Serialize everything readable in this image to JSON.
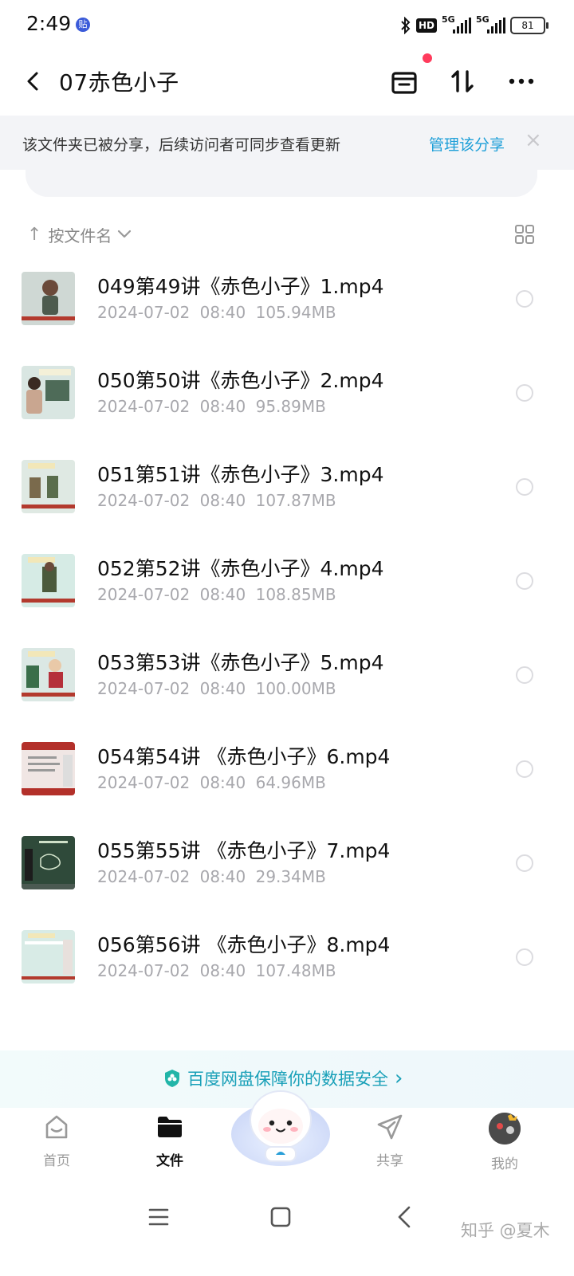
{
  "status_bar": {
    "time": "2:49",
    "badge": "贴",
    "hd": "HD",
    "net1": "5G",
    "net2": "5G",
    "battery": "81"
  },
  "header": {
    "title": "07赤色小子",
    "icons": [
      "back-icon",
      "recycle-bin-icon",
      "transfer-icon",
      "more-icon"
    ]
  },
  "share_banner": {
    "text": "该文件夹已被分享，后续访问者可同步查看更新",
    "link": "管理该分享",
    "close": "×"
  },
  "sort": {
    "label": "按文件名"
  },
  "files": [
    {
      "name": "049第49讲《赤色小子》1.mp4",
      "date": "2024-07-02",
      "time": "08:40",
      "size": "105.94MB",
      "thumb_color": "#cfd8d4"
    },
    {
      "name": "050第50讲《赤色小子》2.mp4",
      "date": "2024-07-02",
      "time": "08:40",
      "size": "95.89MB",
      "thumb_color": "#d9e6e2"
    },
    {
      "name": "051第51讲《赤色小子》3.mp4",
      "date": "2024-07-02",
      "time": "08:40",
      "size": "107.87MB",
      "thumb_color": "#dfe9e3"
    },
    {
      "name": "052第52讲《赤色小子》4.mp4",
      "date": "2024-07-02",
      "time": "08:40",
      "size": "108.85MB",
      "thumb_color": "#d6ebe5"
    },
    {
      "name": "053第53讲《赤色小子》5.mp4",
      "date": "2024-07-02",
      "time": "08:40",
      "size": "100.00MB",
      "thumb_color": "#dbe8e4"
    },
    {
      "name": "054第54讲 《赤色小子》6.mp4",
      "date": "2024-07-02",
      "time": "08:40",
      "size": "64.96MB",
      "thumb_color": "#f0e6e4"
    },
    {
      "name": "055第55讲 《赤色小子》7.mp4",
      "date": "2024-07-02",
      "time": "08:40",
      "size": "29.34MB",
      "thumb_color": "#2f4a3a"
    },
    {
      "name": "056第56讲 《赤色小子》8.mp4",
      "date": "2024-07-02",
      "time": "08:40",
      "size": "107.48MB",
      "thumb_color": "#d8ebe6"
    }
  ],
  "security": {
    "text": "百度网盘保障你的数据安全",
    "chevron": "›"
  },
  "tabs": [
    {
      "label": "首页",
      "icon": "home-icon"
    },
    {
      "label": "文件",
      "icon": "folder-icon",
      "active": true
    },
    {
      "label": "共享",
      "icon": "share-icon"
    },
    {
      "label": "我的",
      "icon": "avatar-icon"
    }
  ],
  "watermark": "知乎 @夏木"
}
